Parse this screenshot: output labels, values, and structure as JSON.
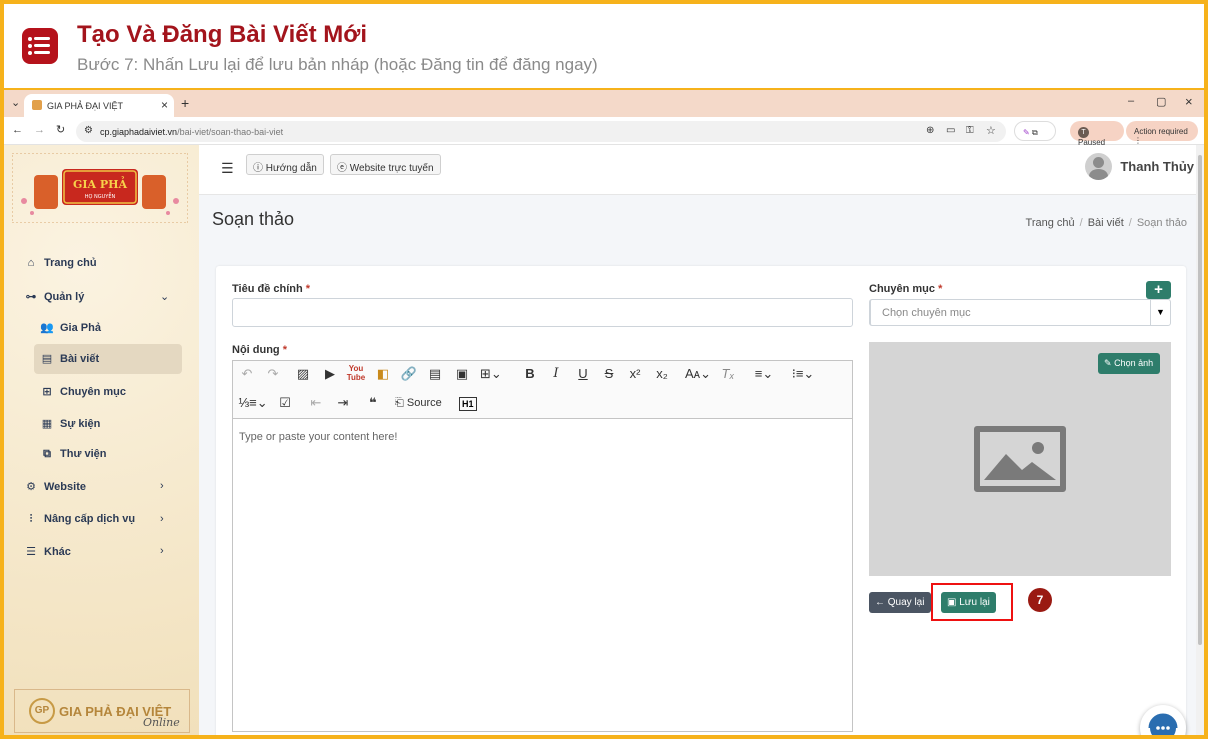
{
  "banner": {
    "title": "Tạo Và Đăng Bài Viết Mới",
    "subtitle": "Bước 7: Nhấn Lưu lại để lưu bản nháp (hoặc Đăng tin để đăng ngay)"
  },
  "browser": {
    "tab_title": "GIA PHẢ ĐẠI VIỆT",
    "url_domain": "cp.giaphadaiviet.vn",
    "url_path": "/bai-viet/soan-thao-bai-viet",
    "paused_label": "Paused",
    "paused_avatar": "T",
    "action_label": "Action required"
  },
  "sidebar": {
    "logo_text": "GIA PHẢ",
    "logo_sub": "HỌ NGUYỄN",
    "items": [
      {
        "label": "Trang chủ",
        "icon": "home-icon"
      },
      {
        "label": "Quản lý",
        "icon": "sitemap-icon"
      },
      {
        "label": "Gia Phả",
        "icon": "users-icon"
      },
      {
        "label": "Bài viết",
        "icon": "newspaper-icon"
      },
      {
        "label": "Chuyên mục",
        "icon": "table-icon"
      },
      {
        "label": "Sự kiện",
        "icon": "calendar-icon"
      },
      {
        "label": "Thư viện",
        "icon": "images-icon"
      },
      {
        "label": "Website",
        "icon": "gear-icon"
      },
      {
        "label": "Nâng cấp dịch vụ",
        "icon": "chart-icon"
      },
      {
        "label": "Khác",
        "icon": "menu-icon"
      }
    ],
    "footer_logo": "GIA PHẢ ĐẠI VIỆT",
    "footer_sub": "Online"
  },
  "appbar": {
    "guide_label": "Hướng dẫn",
    "website_label": "Website trực tuyến",
    "user_name": "Thanh Thủy"
  },
  "page": {
    "title": "Soạn thảo",
    "breadcrumb": [
      "Trang chủ",
      "Bài viết",
      "Soạn thảo"
    ]
  },
  "form": {
    "title_label": "Tiêu đề chính",
    "category_label": "Chuyên mục",
    "category_placeholder": "Chọn chuyên mục",
    "content_label": "Nội dung",
    "required_mark": "*",
    "editor_placeholder": "Type or paste your content here!",
    "source_label": "Source",
    "choose_image_label": "Chọn ảnh",
    "back_label": "Quay lại",
    "save_label": "Lưu lại",
    "step_number": "7"
  },
  "colors": {
    "accent": "#2e7d6b",
    "banner_title": "#a3141c",
    "frame": "#f6b21b",
    "highlight": "#e11111"
  }
}
